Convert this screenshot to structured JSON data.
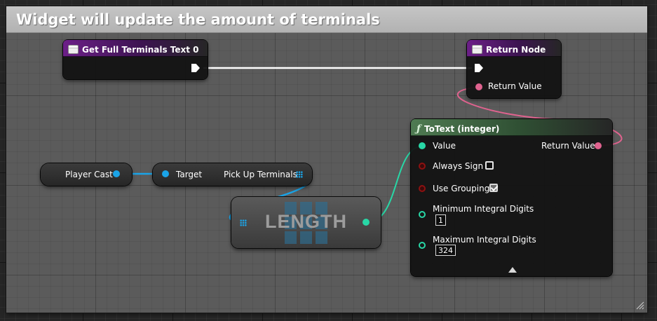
{
  "comment": {
    "title": "Widget will update the amount of terminals"
  },
  "nodes": {
    "get_full": {
      "title": "Get Full Terminals Text 0"
    },
    "return_node": {
      "title": "Return Node",
      "pin_return": "Return Value"
    },
    "player_cast": {
      "label": "Player Cast"
    },
    "pickup": {
      "target": "Target",
      "output": "Pick Up Terminals"
    },
    "length": {
      "title": "LENGTH"
    },
    "totext": {
      "title": "ToText (integer)",
      "value": "Value",
      "return_value": "Return Value",
      "always_sign": {
        "label": "Always Sign",
        "checked": false
      },
      "use_grouping": {
        "label": "Use Grouping",
        "checked": true
      },
      "min_digits": {
        "label": "Minimum Integral Digits",
        "value": "1"
      },
      "max_digits": {
        "label": "Maximum Integral Digits",
        "value": "324"
      }
    }
  },
  "colors": {
    "exec_wire": "#ffffff",
    "text_wire": "#e0638f",
    "int_wire": "#28d7a6",
    "object_wire": "#1aa4e8",
    "bool_pin": "#8e1111"
  },
  "icons": {
    "event": "event-icon",
    "function": "function-icon",
    "collapse": "collapse-arrow-icon",
    "resize": "resize-grip-icon"
  }
}
